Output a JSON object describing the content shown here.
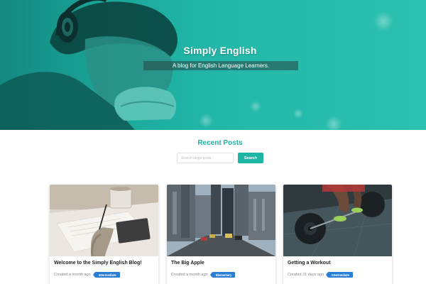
{
  "hero": {
    "title": "Simply English",
    "subtitle": "A blog for English Language Learners."
  },
  "recent_posts": {
    "heading": "Recent Posts",
    "search_placeholder": "Search blogs posts",
    "search_button": "Search"
  },
  "posts": [
    {
      "title": "Welcome to the Simply English Blog!",
      "created": "Created a month ago",
      "level": "Intermediate"
    },
    {
      "title": "The Big Apple",
      "created": "Created a month ago",
      "level": "Elementary"
    },
    {
      "title": "Getting a Workout",
      "created": "Created 21 days ago",
      "level": "Intermediate"
    }
  ],
  "colors": {
    "brand_teal": "#1fb5a5",
    "tag_blue": "#2a7fd4"
  }
}
